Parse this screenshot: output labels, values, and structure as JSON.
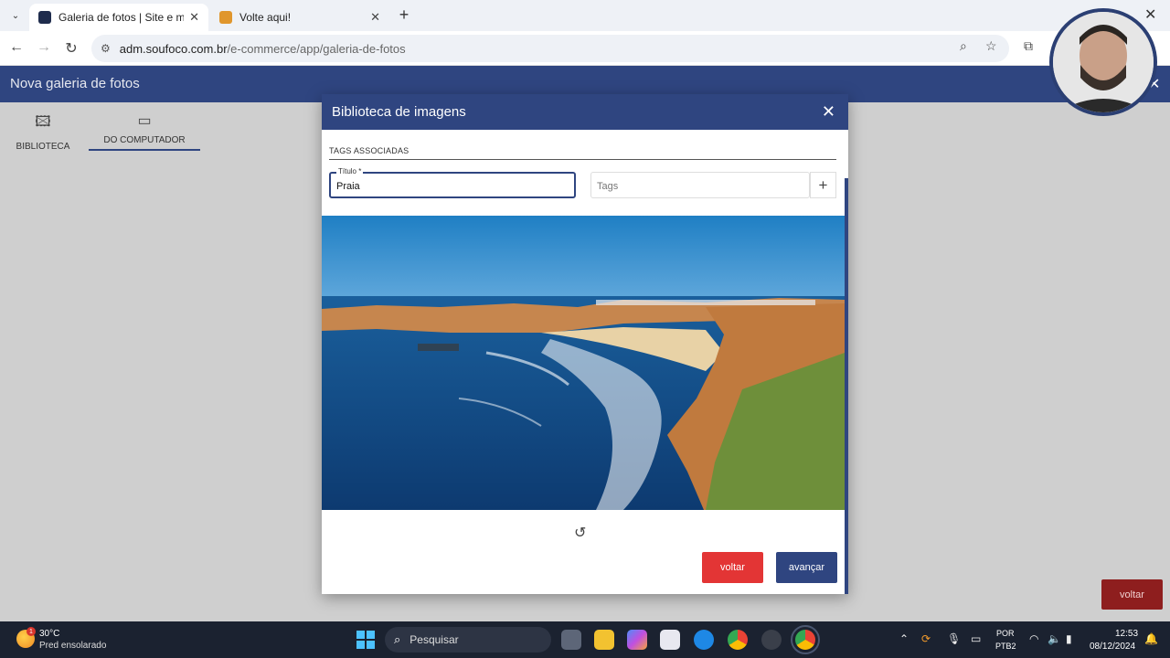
{
  "browser": {
    "tabs": [
      {
        "title": "Galeria de fotos | Site e motor",
        "active": true
      },
      {
        "title": "Volte aqui!",
        "active": false
      }
    ],
    "url_host": "adm.soufoco.com.br",
    "url_path": "/e-commerce/app/galeria-de-fotos"
  },
  "app": {
    "title": "Nova galeria de fotos",
    "tabs": [
      {
        "label": "BIBLIOTECA",
        "icon": "image-add-icon"
      },
      {
        "label": "DO COMPUTADOR",
        "icon": "laptop-icon",
        "selected": true
      }
    ],
    "back_label": "voltar"
  },
  "modal": {
    "title": "Biblioteca de imagens",
    "section_label": "TAGS ASSOCIADAS",
    "title_field_label": "Título *",
    "title_field_value": "Praia",
    "tags_placeholder": "Tags",
    "back_button": "voltar",
    "next_button": "avançar"
  },
  "taskbar": {
    "weather_temp": "30°C",
    "weather_desc": "Pred ensolarado",
    "weather_badge": "1",
    "search_label": "Pesquisar",
    "lang_line1": "POR",
    "lang_line2": "PTB2",
    "time": "12:53",
    "date": "08/12/2024"
  },
  "colors": {
    "header": "#2f4580",
    "danger": "#e33535",
    "primary": "#2f4580"
  }
}
